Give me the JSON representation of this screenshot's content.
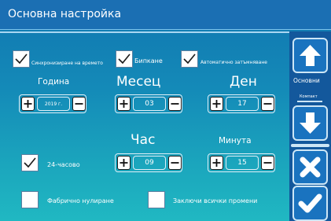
{
  "window": {
    "title": "Основна настройка"
  },
  "checkboxes": {
    "sync_time": {
      "label": "Синхронизиране на времето",
      "checked": true
    },
    "beep": {
      "label": "Бипкане",
      "checked": true
    },
    "auto_dim": {
      "label": "Автоматично затъмняване",
      "checked": true
    },
    "hour24": {
      "label": "24-часово",
      "checked": true
    },
    "factory_reset": {
      "label": "Фабрично нулиране",
      "checked": false
    },
    "lock_changes": {
      "label": "Заключи всички промени",
      "checked": false
    }
  },
  "fields": {
    "year": {
      "label": "Година",
      "value": "2019 г."
    },
    "month": {
      "label": "Месец",
      "value": "03"
    },
    "day": {
      "label": "Ден",
      "value": "17"
    },
    "hour": {
      "label": "Час",
      "value": "09"
    },
    "minute": {
      "label": "Минута",
      "value": "15"
    }
  },
  "sidebar": {
    "page_label": "Основни",
    "sub_label": "Компакт",
    "up_icon": "arrow-up-icon",
    "down_icon": "arrow-down-icon",
    "cancel_icon": "cross-icon",
    "confirm_icon": "check-icon"
  },
  "colors": {
    "title_bar": "#1b6fb3",
    "sidebar": "#13589c",
    "button": "#1a73bf",
    "gradient_top": "#1176b0",
    "gradient_bottom": "#20b8c2"
  }
}
